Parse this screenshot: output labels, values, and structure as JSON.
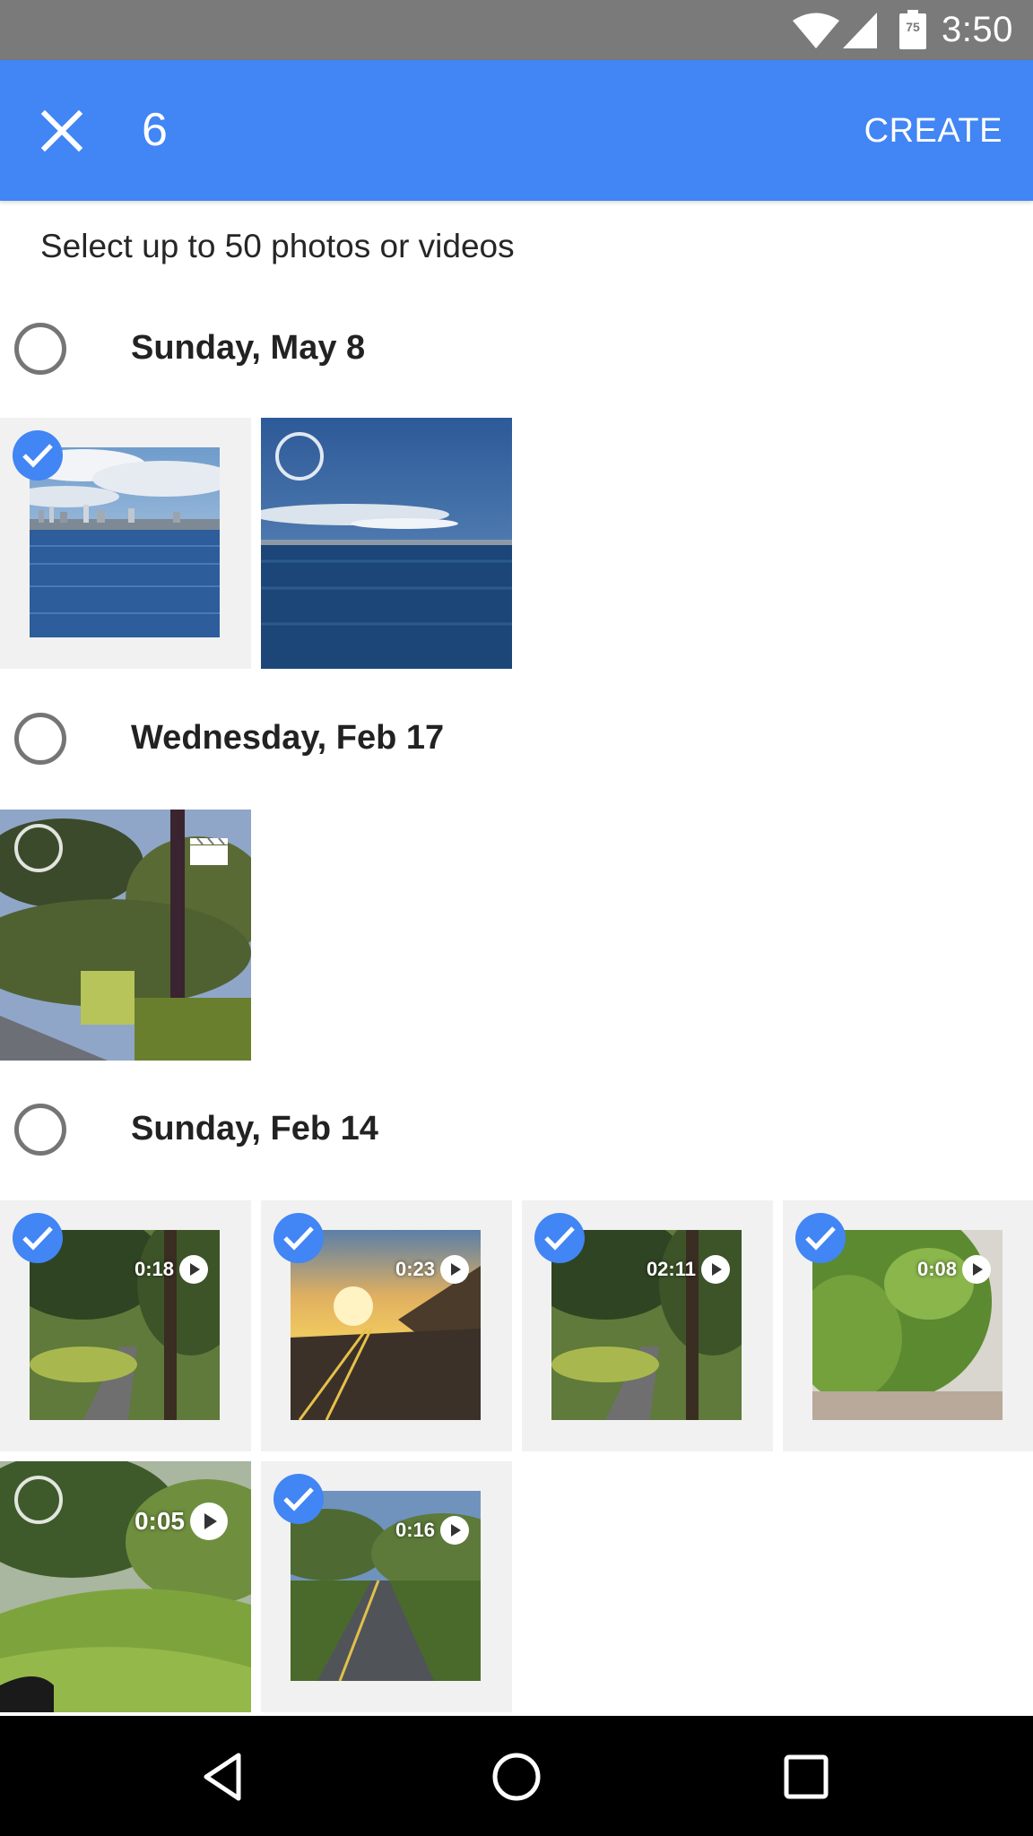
{
  "status_bar": {
    "time": "3:50",
    "battery_level": "75",
    "icons": [
      "wifi-icon",
      "cell-signal-icon",
      "battery-icon"
    ]
  },
  "app_bar": {
    "close_icon": "close-icon",
    "selected_count": "6",
    "create_label": "CREATE",
    "color": "#4285f4"
  },
  "hint": "Select up to 50 photos or videos",
  "sections": [
    {
      "date": "Sunday, May 8",
      "items": [
        {
          "type": "photo",
          "selected": true,
          "subject": "city skyline over bay"
        },
        {
          "type": "photo",
          "selected": false,
          "subject": "ocean and distant shore"
        }
      ]
    },
    {
      "date": "Wednesday, Feb 17",
      "items": [
        {
          "type": "video",
          "selected": false,
          "subject": "trees and road",
          "badge": "clapper-icon"
        }
      ]
    },
    {
      "date": "Sunday, Feb 14",
      "items": [
        {
          "type": "video",
          "selected": true,
          "duration": "0:18",
          "subject": "winding road under trees"
        },
        {
          "type": "video",
          "selected": true,
          "duration": "0:23",
          "subject": "sunset road"
        },
        {
          "type": "video",
          "selected": true,
          "duration": "02:11",
          "subject": "winding road under trees"
        },
        {
          "type": "video",
          "selected": true,
          "duration": "0:08",
          "subject": "green hedge"
        },
        {
          "type": "video",
          "selected": false,
          "duration": "0:05",
          "subject": "grassy hill from car"
        },
        {
          "type": "video",
          "selected": true,
          "duration": "0:16",
          "subject": "country road"
        }
      ]
    }
  ],
  "nav_bar": {
    "icons": [
      "back-icon",
      "home-icon",
      "recents-icon"
    ]
  }
}
